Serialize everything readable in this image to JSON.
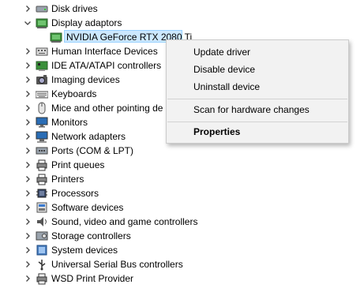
{
  "tree": {
    "categories": [
      {
        "label": "Disk drives",
        "icon": "disk-drive-icon",
        "expanded": false
      },
      {
        "label": "Display adaptors",
        "icon": "display-adapter-icon",
        "expanded": true
      },
      {
        "label": "Human Interface Devices",
        "icon": "hid-icon",
        "expanded": false
      },
      {
        "label": "IDE ATA/ATAPI controllers",
        "icon": "ide-controller-icon",
        "expanded": false
      },
      {
        "label": "Imaging devices",
        "icon": "camera-icon",
        "expanded": false
      },
      {
        "label": "Keyboards",
        "icon": "keyboard-icon",
        "expanded": false
      },
      {
        "label": "Mice and other pointing de",
        "icon": "mouse-icon",
        "expanded": false
      },
      {
        "label": "Monitors",
        "icon": "monitor-icon",
        "expanded": false
      },
      {
        "label": "Network adapters",
        "icon": "network-adapter-icon",
        "expanded": false
      },
      {
        "label": "Ports (COM & LPT)",
        "icon": "port-icon",
        "expanded": false
      },
      {
        "label": "Print queues",
        "icon": "print-queue-icon",
        "expanded": false
      },
      {
        "label": "Printers",
        "icon": "printer-icon",
        "expanded": false
      },
      {
        "label": "Processors",
        "icon": "processor-icon",
        "expanded": false
      },
      {
        "label": "Software devices",
        "icon": "software-device-icon",
        "expanded": false
      },
      {
        "label": "Sound, video and game controllers",
        "icon": "speaker-icon",
        "expanded": false
      },
      {
        "label": "Storage controllers",
        "icon": "storage-controller-icon",
        "expanded": false
      },
      {
        "label": "System devices",
        "icon": "system-device-icon",
        "expanded": false
      },
      {
        "label": "Universal Serial Bus controllers",
        "icon": "usb-icon",
        "expanded": false
      },
      {
        "label": "WSD Print Provider",
        "icon": "wsd-printer-icon",
        "expanded": false
      }
    ],
    "display_children": [
      {
        "label": "NVIDIA GeForce RTX 2080 Ti",
        "icon": "display-adapter-icon",
        "selected": true
      }
    ]
  },
  "context_menu": {
    "items": [
      {
        "label": "Update driver",
        "bold": false
      },
      {
        "label": "Disable device",
        "bold": false
      },
      {
        "label": "Uninstall device",
        "bold": false
      },
      {
        "label": "Scan for hardware changes",
        "bold": false
      },
      {
        "label": "Properties",
        "bold": true
      }
    ]
  },
  "colors": {
    "selection_fill": "#cce8ff",
    "selection_border": "#99d1ff",
    "menu_background": "#f2f2f2",
    "icon_green": "#3a8f3a"
  }
}
